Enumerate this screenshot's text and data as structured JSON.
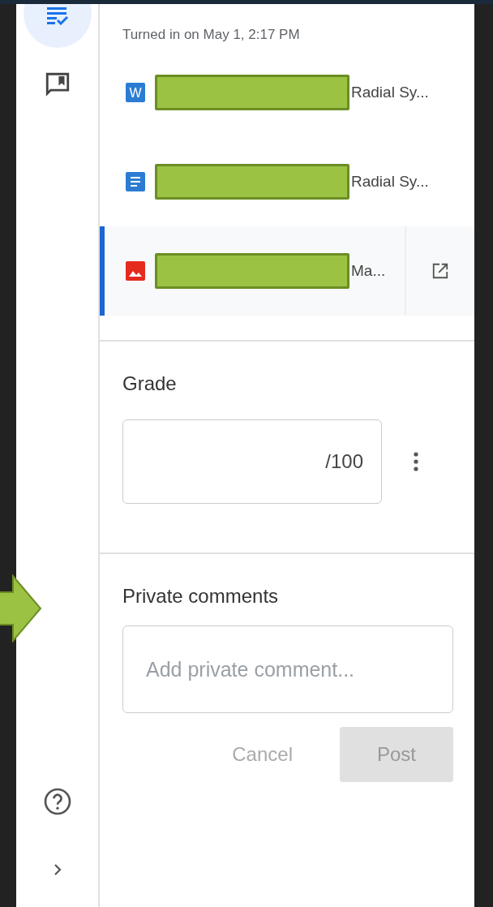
{
  "turned_in": "Turned in on May 1, 2:17 PM",
  "files": [
    {
      "kind": "word",
      "name": "Radial Sy...",
      "selected": false
    },
    {
      "kind": "doc",
      "name": "Radial Sy...",
      "selected": false
    },
    {
      "kind": "image",
      "name": "Ma...",
      "selected": true
    }
  ],
  "grade": {
    "label": "Grade",
    "suffix": "/100"
  },
  "private_comments": {
    "label": "Private comments",
    "placeholder": "Add private comment...",
    "buttons": [
      {
        "label": "Cancel",
        "kind": "text"
      },
      {
        "label": "Post",
        "kind": "filled"
      }
    ]
  },
  "w_letter": "W"
}
